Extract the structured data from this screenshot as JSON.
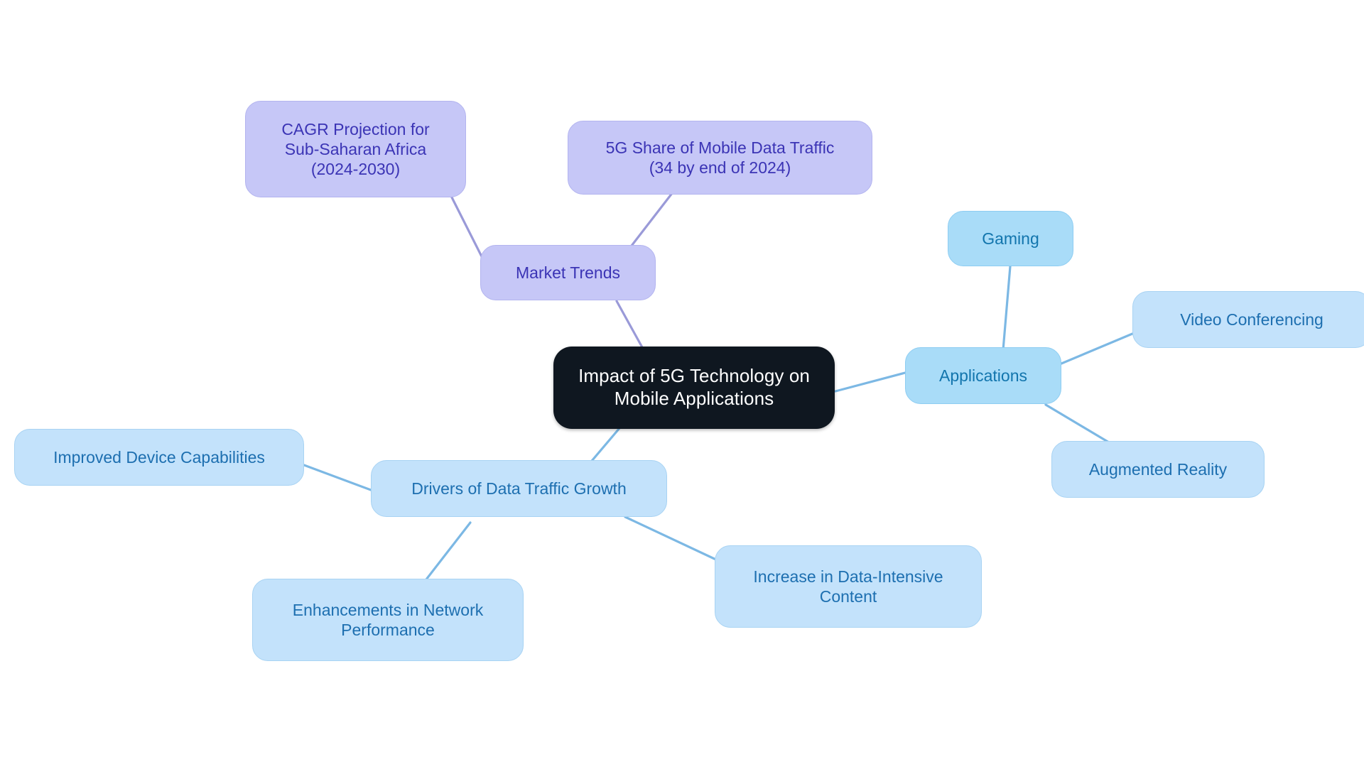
{
  "diagram": {
    "type": "mindmap",
    "title": "Impact of 5G Technology on Mobile Applications",
    "background_color": "#ffffff",
    "palette": {
      "central_fill": "#0f1720",
      "central_text": "#ffffff",
      "purple_fill": "#c6c7f7",
      "purple_border": "#b3b4ef",
      "purple_text": "#3b34b5",
      "blue_strong_fill": "#a9dcf8",
      "blue_strong_border": "#8ecdf2",
      "blue_strong_text": "#1275ad",
      "blue_light_fill": "#c3e2fb",
      "blue_light_border": "#a8d3f3",
      "blue_light_text": "#1d6fb0",
      "edge_blue": "#7cb8e4",
      "edge_purple": "#9a9ad8"
    }
  },
  "nodes": {
    "central": {
      "label": "Impact of 5G Technology on\nMobile Applications"
    },
    "market_trends": {
      "label": "Market Trends"
    },
    "cagr_projection": {
      "label": "CAGR Projection for\nSub-Saharan Africa\n(2024-2030)"
    },
    "5g_share": {
      "label": "5G Share of Mobile Data Traffic\n(34 by end of 2024)"
    },
    "applications": {
      "label": "Applications"
    },
    "gaming": {
      "label": "Gaming"
    },
    "video_conferencing": {
      "label": "Video Conferencing"
    },
    "augmented_reality": {
      "label": "Augmented Reality"
    },
    "drivers": {
      "label": "Drivers of Data Traffic Growth"
    },
    "improved_device": {
      "label": "Improved Device Capabilities"
    },
    "network_performance": {
      "label": "Enhancements in Network\nPerformance"
    },
    "data_intensive": {
      "label": "Increase in Data-Intensive\nContent"
    }
  },
  "edges": [
    {
      "from": "central",
      "to": "market_trends"
    },
    {
      "from": "market_trends",
      "to": "cagr_projection"
    },
    {
      "from": "market_trends",
      "to": "5g_share"
    },
    {
      "from": "central",
      "to": "applications"
    },
    {
      "from": "applications",
      "to": "gaming"
    },
    {
      "from": "applications",
      "to": "video_conferencing"
    },
    {
      "from": "applications",
      "to": "augmented_reality"
    },
    {
      "from": "central",
      "to": "drivers"
    },
    {
      "from": "drivers",
      "to": "improved_device"
    },
    {
      "from": "drivers",
      "to": "network_performance"
    },
    {
      "from": "drivers",
      "to": "data_intensive"
    }
  ]
}
